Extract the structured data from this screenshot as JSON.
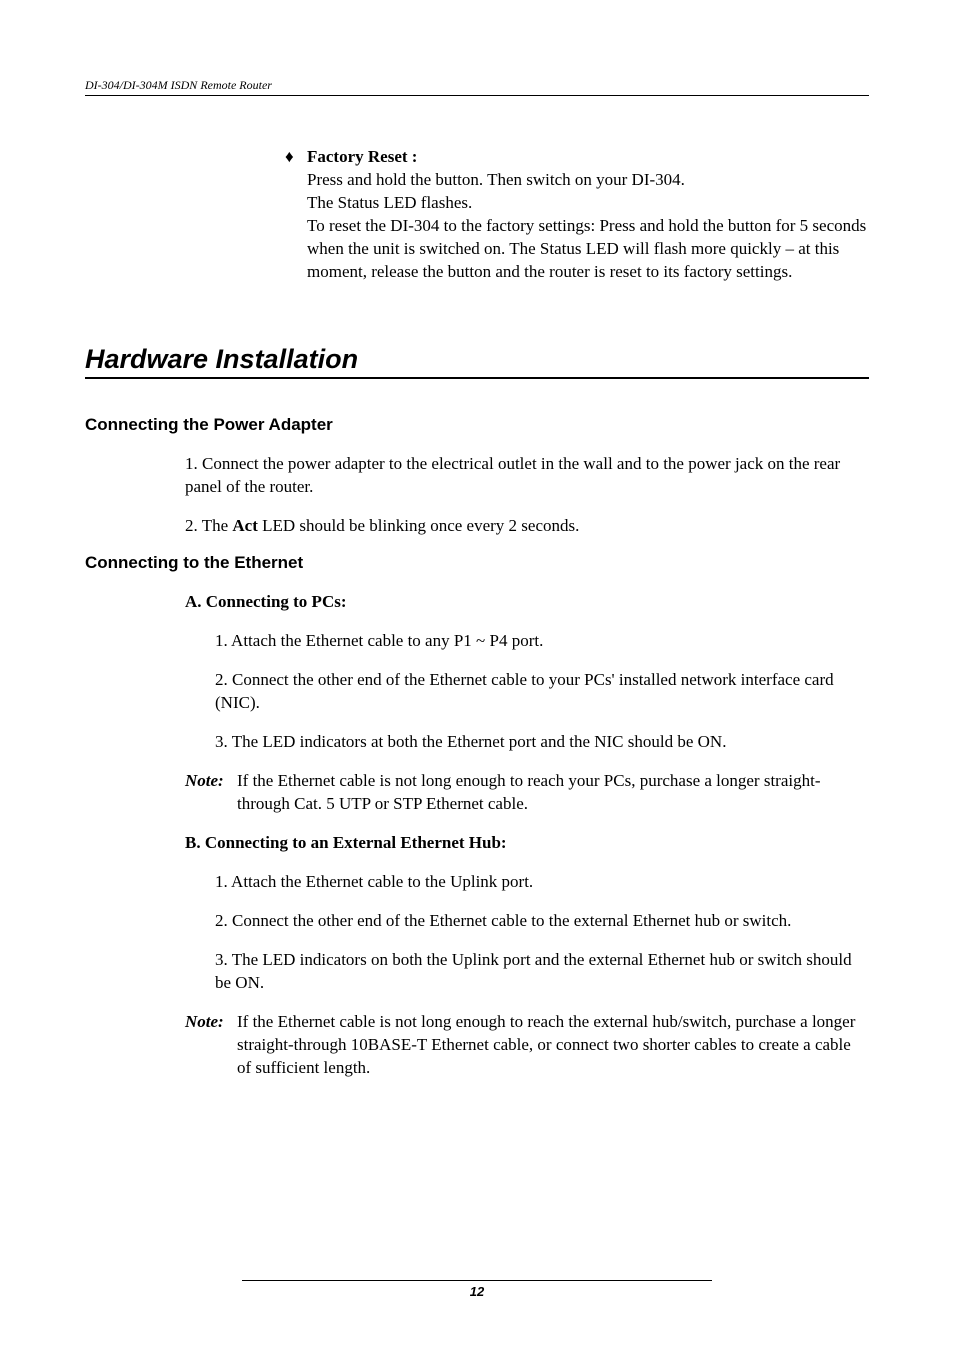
{
  "header": "DI-304/DI-304M ISDN Remote Router",
  "bullet": {
    "symbol": "♦",
    "title": "Factory Reset :",
    "line1": "Press and hold the button. Then switch on your DI-304.",
    "line2": "The Status LED flashes.",
    "line3": "To reset the DI-304 to the factory settings: Press and hold the button for 5 seconds when the unit is switched on. The Status LED will flash more quickly – at this moment, release the button and the router is reset to its factory settings."
  },
  "section_title": "Hardware Installation",
  "sub1": {
    "heading": "Connecting the Power Adapter",
    "p1": "1. Connect the power adapter to the electrical outlet in the wall and to the power jack on the rear panel of the router.",
    "p2_prefix": "2. The ",
    "p2_bold": "Act",
    "p2_suffix": " LED should be blinking once every 2 seconds."
  },
  "sub2": {
    "heading": "Connecting to the Ethernet",
    "a_title": "A. Connecting to PCs:",
    "a1": "1. Attach the Ethernet cable to any P1 ~ P4 port.",
    "a2": "2. Connect the other end of the Ethernet cable to your PCs' installed network interface card (NIC).",
    "a3": "3. The LED indicators at both the Ethernet port and the NIC should be ON.",
    "note_label": "Note:",
    "note_a": "If the Ethernet cable is not long enough to reach your PCs, purchase a longer straight-through Cat. 5 UTP or STP Ethernet cable.",
    "b_title": "B. Connecting to an External Ethernet Hub:",
    "b1": "1. Attach the Ethernet cable to the Uplink port.",
    "b2": "2. Connect the other end of the Ethernet cable to the external Ethernet hub or switch.",
    "b3": "3. The LED indicators on both the Uplink port and the external Ethernet hub or switch should be ON.",
    "note_b": "If the Ethernet cable is not long enough to reach the external hub/switch, purchase a longer straight-through 10BASE-T Ethernet cable, or connect two shorter cables to create a cable of sufficient length."
  },
  "page_number": "12"
}
